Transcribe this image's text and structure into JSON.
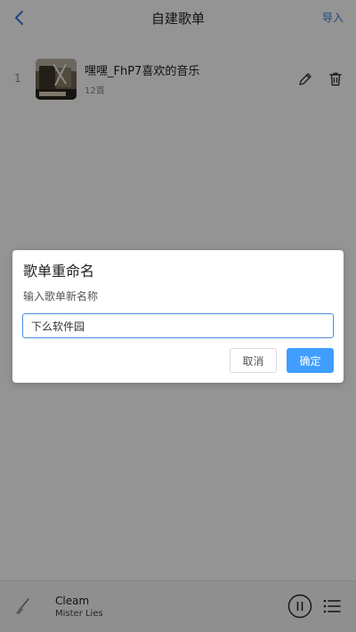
{
  "header": {
    "title": "自建歌单",
    "import_label": "导入",
    "back_icon": "chevron-left-icon"
  },
  "playlists": [
    {
      "index": "1",
      "name": "嘿嘿_FhP7喜欢的音乐",
      "count": "12首"
    }
  ],
  "player": {
    "song": "Cleam",
    "artist": "Mister Lies",
    "pause_icon": "pause-circle-icon",
    "queue_icon": "list-icon"
  },
  "dialog": {
    "title": "歌单重命名",
    "label": "输入歌单新名称",
    "input_value": "下么软件园",
    "cancel_label": "取消",
    "ok_label": "确定"
  },
  "colors": {
    "accent": "#409eff",
    "link": "#2f7fd6",
    "overlay": "rgba(0,0,0,0.42)"
  }
}
